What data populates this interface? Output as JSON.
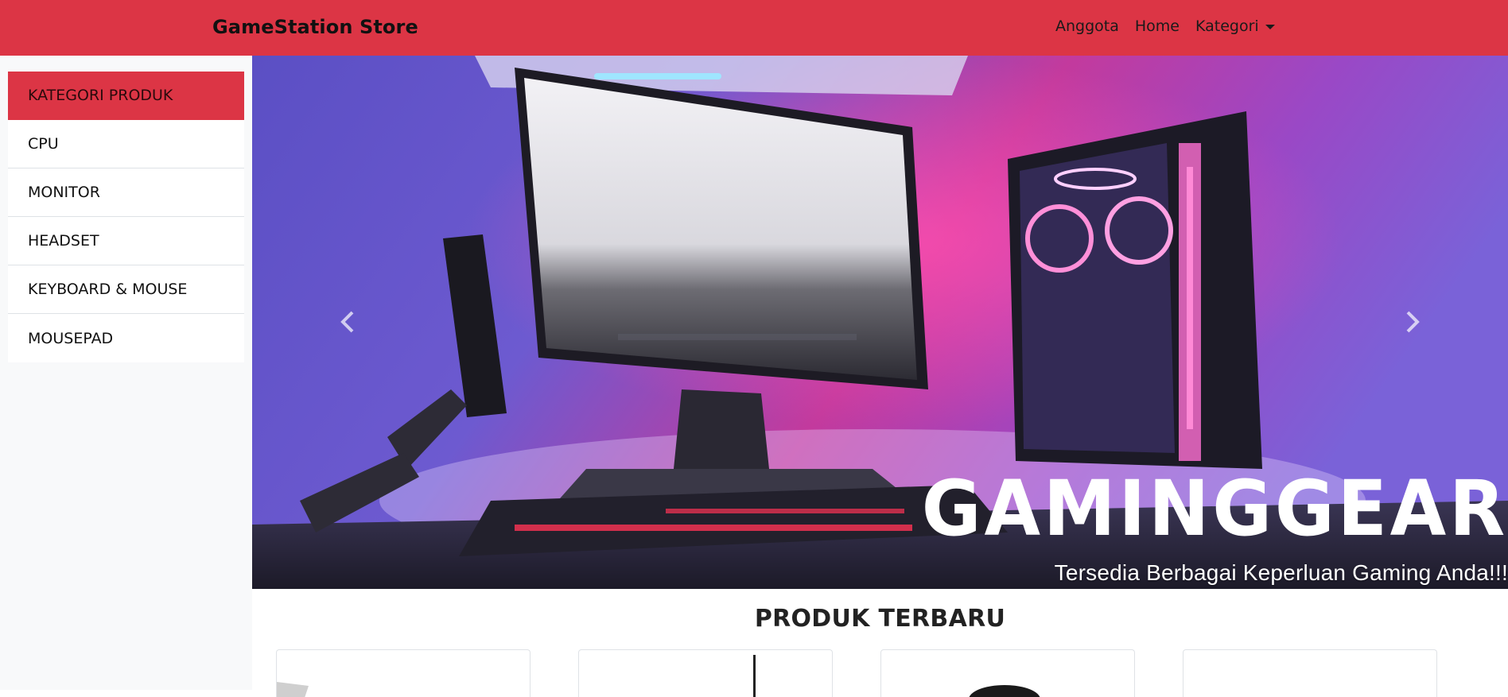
{
  "navbar": {
    "brand": "GameStation Store",
    "links": [
      "Anggota",
      "Home",
      "Kategori"
    ],
    "accent_color": "#dc3545"
  },
  "sidebar": {
    "items": [
      {
        "label": "KATEGORI PRODUK",
        "active": true
      },
      {
        "label": "CPU",
        "active": false
      },
      {
        "label": "MONITOR",
        "active": false
      },
      {
        "label": "HEADSET",
        "active": false
      },
      {
        "label": "KEYBOARD & MOUSE",
        "active": false
      },
      {
        "label": "MOUSEPAD",
        "active": false
      }
    ]
  },
  "carousel": {
    "logo": "GAMINGGEAR",
    "caption": "Tersedia Berbagai Keperluan Gaming Anda!!!",
    "prev_icon": "chevron-left-icon",
    "next_icon": "chevron-right-icon"
  },
  "products": {
    "title": "PRODUK TERBARU"
  }
}
